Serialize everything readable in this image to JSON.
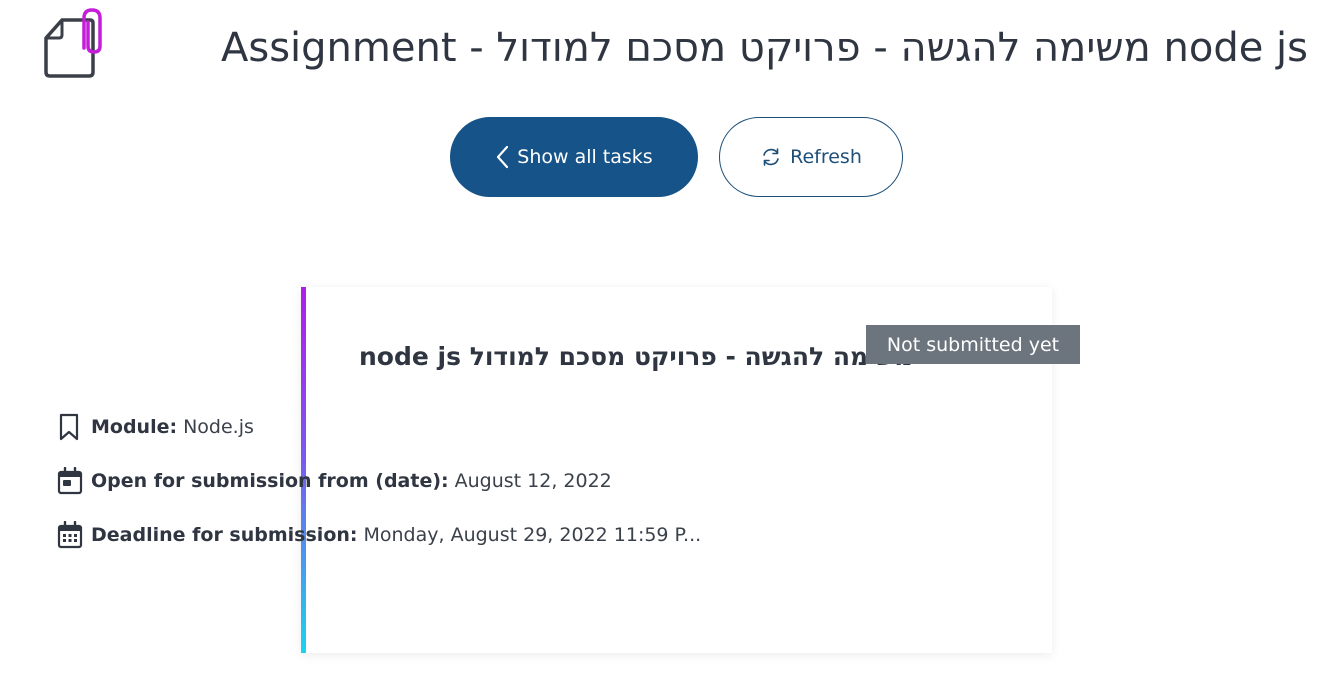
{
  "header": {
    "icon": "assignment-file-icon",
    "title": "Assignment - משימה להגשה - פרויקט מסכם למודול node js",
    "icon_colors": {
      "paper": "#3b4048",
      "clip": "#c41ed8"
    }
  },
  "actions": {
    "show_all": {
      "label": "Show all tasks",
      "icon": "chevron-left-icon"
    },
    "refresh": {
      "label": "Refresh",
      "icon": "refresh-icon"
    }
  },
  "card": {
    "title": "משימה להגשה - פרויקט מסכם למודול node js",
    "status": "Not submitted yet",
    "details": {
      "module": {
        "icon": "bookmark-icon",
        "label": "Module:",
        "value": "Node.js"
      },
      "open_from": {
        "icon": "calendar-icon",
        "label": "Open for submission from (date):",
        "value": "August 12, 2022"
      },
      "deadline": {
        "icon": "calendar-grid-icon",
        "label": "Deadline for submission:",
        "value": "Monday, August 29, 2022 11:59 P..."
      }
    }
  },
  "colors": {
    "primary": "#165388",
    "outline": "#1d4f78",
    "badge": "#6c747d",
    "accent_top": "#b01ee8",
    "accent_bottom": "#1ad4ee"
  }
}
